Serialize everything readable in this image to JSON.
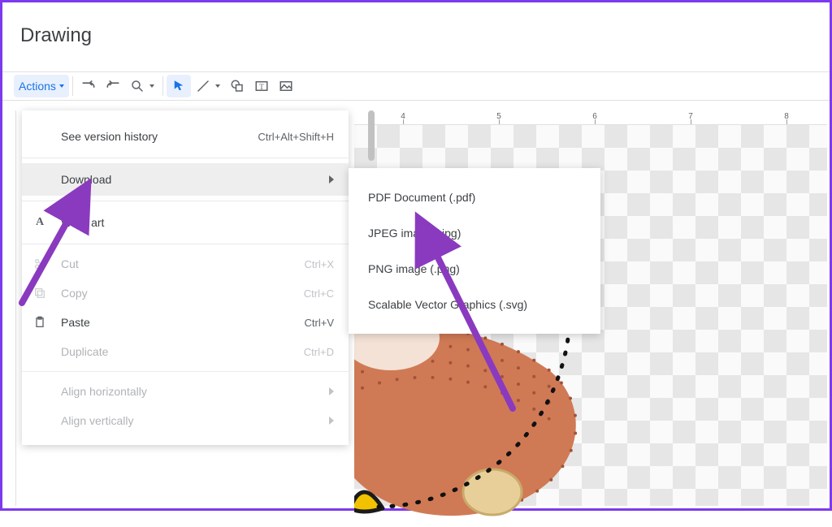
{
  "header": {
    "title": "Drawing"
  },
  "toolbar": {
    "actions_label": "Actions"
  },
  "ruler": {
    "numbers": [
      "4",
      "5",
      "6",
      "7",
      "8"
    ]
  },
  "actions_menu": {
    "see_version_history": {
      "label": "See version history",
      "shortcut": "Ctrl+Alt+Shift+H"
    },
    "download": {
      "label": "Download"
    },
    "word_art": {
      "label": "Word art"
    },
    "cut": {
      "label": "Cut",
      "shortcut": "Ctrl+X"
    },
    "copy": {
      "label": "Copy",
      "shortcut": "Ctrl+C"
    },
    "paste": {
      "label": "Paste",
      "shortcut": "Ctrl+V"
    },
    "duplicate": {
      "label": "Duplicate",
      "shortcut": "Ctrl+D"
    },
    "align_horizontally": {
      "label": "Align horizontally"
    },
    "align_vertically": {
      "label": "Align vertically"
    }
  },
  "download_menu": {
    "pdf": {
      "label": "PDF Document (.pdf)"
    },
    "jpeg": {
      "label": "JPEG image (.jpg)"
    },
    "png": {
      "label": "PNG image (.png)"
    },
    "svg": {
      "label": "Scalable Vector Graphics (.svg)"
    }
  },
  "colors": {
    "accent": "#1a73e8",
    "arrow": "#8a3abf"
  }
}
